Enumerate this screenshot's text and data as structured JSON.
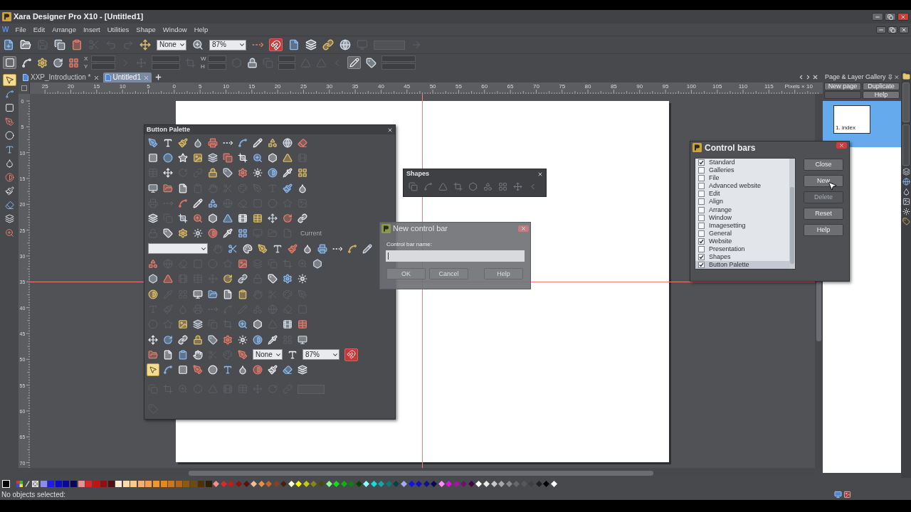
{
  "window": {
    "title": "Xara Designer Pro X10 - [Untitled1]"
  },
  "menu": {
    "doc_icon": "W",
    "items": [
      "File",
      "Edit",
      "Arrange",
      "Insert",
      "Utilities",
      "Shape",
      "Window",
      "Help"
    ]
  },
  "standard_bar": {
    "items": [
      {
        "kind": "button",
        "disabled": false
      },
      {
        "kind": "button",
        "disabled": false
      },
      {
        "kind": "button",
        "disabled": true
      },
      {
        "kind": "button",
        "disabled": false
      },
      {
        "kind": "button",
        "disabled": false
      },
      {
        "kind": "button",
        "disabled": true
      },
      {
        "kind": "button",
        "disabled": true
      },
      {
        "kind": "button",
        "disabled": true
      },
      {
        "kind": "button",
        "disabled": false
      },
      {
        "kind": "select",
        "value": "None"
      },
      {
        "kind": "button",
        "disabled": false
      },
      {
        "kind": "select",
        "value": "87%"
      },
      {
        "kind": "button",
        "disabled": false
      },
      {
        "kind": "toggle",
        "on": true
      },
      {
        "kind": "button",
        "disabled": false
      },
      {
        "kind": "button",
        "disabled": false
      },
      {
        "kind": "button",
        "disabled": false
      },
      {
        "kind": "button",
        "disabled": false
      },
      {
        "kind": "button",
        "disabled": true
      },
      {
        "kind": "field"
      },
      {
        "kind": "button",
        "disabled": true
      }
    ]
  },
  "info_bar": {
    "items": [
      {
        "kind": "toggle",
        "on": true
      },
      {
        "kind": "button",
        "disabled": false
      },
      {
        "kind": "button",
        "disabled": false
      },
      {
        "kind": "button",
        "disabled": false
      },
      {
        "kind": "button",
        "disabled": false
      },
      {
        "kind": "fields",
        "labels": [
          "X",
          "Y"
        ]
      },
      {
        "kind": "button",
        "disabled": true
      },
      {
        "kind": "button",
        "disabled": true
      },
      {
        "kind": "fields"
      },
      {
        "kind": "button",
        "disabled": true
      },
      {
        "kind": "fields",
        "labels": [
          "W",
          "H"
        ]
      },
      {
        "kind": "button",
        "disabled": true
      },
      {
        "kind": "button",
        "disabled": false
      },
      {
        "kind": "button",
        "disabled": true
      },
      {
        "kind": "fields"
      },
      {
        "kind": "button",
        "disabled": true
      },
      {
        "kind": "button",
        "disabled": true
      },
      {
        "kind": "button",
        "disabled": true
      },
      {
        "kind": "toggle",
        "on": true
      },
      {
        "kind": "button",
        "disabled": false
      },
      {
        "kind": "fields"
      }
    ]
  },
  "doc_tabs": [
    {
      "label": "XXP_Introduction *",
      "selected": false
    },
    {
      "label": "Untitled1",
      "selected": true
    }
  ],
  "toolbox": {
    "items": [
      {
        "selected": true
      },
      {
        "selected": false
      },
      {
        "selected": false
      },
      {
        "selected": false
      },
      {
        "selected": false
      },
      {
        "selected": false
      },
      {
        "selected": false
      },
      {
        "selected": false
      },
      {
        "selected": false
      },
      {
        "selected": false
      },
      {
        "selected": false
      },
      {
        "selected": false
      }
    ]
  },
  "rulers": {
    "horizontal": [
      "25",
      "20",
      "15",
      "10",
      "5",
      "0",
      "5",
      "10",
      "15",
      "20",
      "25",
      "30",
      "35",
      "40",
      "45",
      "50",
      "55",
      "60",
      "65",
      "70",
      "75",
      "80",
      "85",
      "90",
      "95",
      "100",
      "105",
      "110",
      "115"
    ],
    "unit": "Pixels × 10",
    "vertical": [
      "0",
      "5",
      "10",
      "15",
      "20",
      "25",
      "30",
      "35",
      "40",
      "45",
      "50",
      "55",
      "60",
      "65",
      "70"
    ]
  },
  "button_palette": {
    "title": "Button Palette",
    "rows": [
      {
        "items": [
          {
            "kind": "button",
            "disabled": false
          },
          {
            "kind": "button",
            "disabled": false
          },
          {
            "kind": "button",
            "disabled": false
          },
          {
            "kind": "button",
            "disabled": false
          },
          {
            "kind": "button",
            "disabled": false
          },
          {
            "kind": "button",
            "disabled": false
          },
          {
            "kind": "button",
            "disabled": false
          },
          {
            "kind": "button",
            "disabled": false
          },
          {
            "kind": "button",
            "disabled": false
          },
          {
            "kind": "button",
            "disabled": false
          },
          {
            "kind": "button",
            "disabled": false
          }
        ]
      },
      {
        "items": [
          {
            "kind": "button",
            "disabled": false
          },
          {
            "kind": "button",
            "disabled": false
          },
          {
            "kind": "button",
            "disabled": false
          },
          {
            "kind": "button",
            "disabled": false
          },
          {
            "kind": "button",
            "disabled": false
          },
          {
            "kind": "button",
            "disabled": false
          },
          {
            "kind": "button",
            "disabled": false
          },
          {
            "kind": "button",
            "disabled": false
          },
          {
            "kind": "button",
            "disabled": false
          },
          {
            "kind": "button",
            "disabled": false
          },
          {
            "kind": "button",
            "disabled": true
          }
        ]
      },
      {
        "items": [
          {
            "kind": "button",
            "disabled": true
          },
          {
            "kind": "button",
            "disabled": false
          },
          {
            "kind": "button",
            "disabled": true
          },
          {
            "kind": "button",
            "disabled": true
          },
          {
            "kind": "button",
            "disabled": false
          },
          {
            "kind": "button",
            "disabled": false
          },
          {
            "kind": "button",
            "disabled": false
          },
          {
            "kind": "button",
            "disabled": false
          },
          {
            "kind": "button",
            "disabled": false
          },
          {
            "kind": "button",
            "disabled": false
          },
          {
            "kind": "button",
            "disabled": false
          }
        ]
      },
      {
        "items": [
          {
            "kind": "button",
            "disabled": false
          },
          {
            "kind": "button",
            "disabled": false
          },
          {
            "kind": "button",
            "disabled": false
          },
          {
            "kind": "button",
            "disabled": true
          },
          {
            "kind": "button",
            "disabled": true
          },
          {
            "kind": "button",
            "disabled": true
          },
          {
            "kind": "button",
            "disabled": true
          },
          {
            "kind": "button",
            "disabled": true
          },
          {
            "kind": "button",
            "disabled": true
          },
          {
            "kind": "button",
            "disabled": false
          },
          {
            "kind": "button",
            "disabled": false
          }
        ]
      },
      {
        "items": [
          {
            "kind": "button",
            "disabled": true
          },
          {
            "kind": "button",
            "disabled": true
          },
          {
            "kind": "button",
            "disabled": false
          },
          {
            "kind": "button",
            "disabled": false
          },
          {
            "kind": "button",
            "disabled": false
          },
          {
            "kind": "button",
            "disabled": true
          },
          {
            "kind": "button",
            "disabled": true
          },
          {
            "kind": "button",
            "disabled": true
          },
          {
            "kind": "button",
            "disabled": true
          },
          {
            "kind": "button",
            "disabled": true
          },
          {
            "kind": "button",
            "disabled": true
          }
        ]
      },
      {
        "items": [
          {
            "kind": "button",
            "disabled": false
          },
          {
            "kind": "button",
            "disabled": true
          },
          {
            "kind": "button",
            "disabled": false
          },
          {
            "kind": "button",
            "disabled": false
          },
          {
            "kind": "button",
            "disabled": false
          },
          {
            "kind": "button",
            "disabled": false
          },
          {
            "kind": "button",
            "disabled": false
          },
          {
            "kind": "button",
            "disabled": false
          },
          {
            "kind": "button",
            "disabled": false
          },
          {
            "kind": "button",
            "disabled": false
          },
          {
            "kind": "button",
            "disabled": false
          }
        ]
      },
      {
        "items": [
          {
            "kind": "button",
            "disabled": true
          },
          {
            "kind": "button",
            "disabled": false
          },
          {
            "kind": "button",
            "disabled": false
          },
          {
            "kind": "button",
            "disabled": false
          },
          {
            "kind": "button",
            "disabled": false
          },
          {
            "kind": "button",
            "disabled": false
          },
          {
            "kind": "button",
            "disabled": false
          },
          {
            "kind": "button",
            "disabled": true
          },
          {
            "kind": "button",
            "disabled": true
          },
          {
            "kind": "button",
            "disabled": true
          },
          {
            "kind": "label",
            "text": "Current",
            "disabled": true
          }
        ]
      },
      {
        "items": [
          {
            "kind": "select"
          },
          {
            "kind": "button",
            "disabled": true
          },
          {
            "kind": "button",
            "disabled": false
          },
          {
            "kind": "button",
            "disabled": false
          },
          {
            "kind": "button",
            "disabled": false
          },
          {
            "kind": "button",
            "disabled": false
          },
          {
            "kind": "button",
            "disabled": false
          },
          {
            "kind": "button",
            "disabled": false
          },
          {
            "kind": "button",
            "disabled": false
          },
          {
            "kind": "button",
            "disabled": false
          },
          {
            "kind": "button",
            "disabled": false
          },
          {
            "kind": "button",
            "disabled": false
          }
        ]
      },
      {
        "items": [
          {
            "kind": "button",
            "disabled": false
          },
          {
            "kind": "button",
            "disabled": true
          },
          {
            "kind": "button",
            "disabled": true
          },
          {
            "kind": "button",
            "disabled": true
          },
          {
            "kind": "button",
            "disabled": true
          },
          {
            "kind": "button",
            "disabled": true
          },
          {
            "kind": "button",
            "disabled": false
          },
          {
            "kind": "button",
            "disabled": true
          },
          {
            "kind": "button",
            "disabled": true
          },
          {
            "kind": "button",
            "disabled": true
          },
          {
            "kind": "button",
            "disabled": true
          },
          {
            "kind": "button",
            "disabled": false
          }
        ]
      },
      {
        "items": [
          {
            "kind": "button",
            "disabled": false
          },
          {
            "kind": "button",
            "disabled": false
          },
          {
            "kind": "button",
            "disabled": true
          },
          {
            "kind": "button",
            "disabled": true
          },
          {
            "kind": "button",
            "disabled": true
          },
          {
            "kind": "button",
            "disabled": false
          },
          {
            "kind": "button",
            "disabled": false
          },
          {
            "kind": "button",
            "disabled": true
          },
          {
            "kind": "button",
            "disabled": false
          },
          {
            "kind": "button",
            "disabled": false
          },
          {
            "kind": "button",
            "disabled": false
          }
        ]
      },
      {
        "items": [
          {
            "kind": "button",
            "disabled": false
          },
          {
            "kind": "button",
            "disabled": true
          },
          {
            "kind": "button",
            "disabled": true
          },
          {
            "kind": "button",
            "disabled": false
          },
          {
            "kind": "button",
            "disabled": false
          },
          {
            "kind": "button",
            "disabled": false
          },
          {
            "kind": "button",
            "disabled": false
          },
          {
            "kind": "button",
            "disabled": true
          },
          {
            "kind": "button",
            "disabled": true
          },
          {
            "kind": "button",
            "disabled": true
          },
          {
            "kind": "button",
            "disabled": true
          }
        ]
      },
      {
        "items": [
          {
            "kind": "button",
            "disabled": true
          },
          {
            "kind": "button",
            "disabled": true
          },
          {
            "kind": "button",
            "disabled": true
          },
          {
            "kind": "button",
            "disabled": true
          },
          {
            "kind": "button",
            "disabled": true
          },
          {
            "kind": "button",
            "disabled": true
          },
          {
            "kind": "button",
            "disabled": true
          },
          {
            "kind": "button",
            "disabled": true
          },
          {
            "kind": "button",
            "disabled": true
          },
          {
            "kind": "button",
            "disabled": true
          },
          {
            "kind": "button",
            "disabled": true
          }
        ]
      },
      {
        "items": [
          {
            "kind": "button",
            "disabled": true
          },
          {
            "kind": "button",
            "disabled": true
          },
          {
            "kind": "button",
            "disabled": false
          },
          {
            "kind": "button",
            "disabled": false
          },
          {
            "kind": "button",
            "disabled": true
          },
          {
            "kind": "button",
            "disabled": true
          },
          {
            "kind": "button",
            "disabled": false
          },
          {
            "kind": "button",
            "disabled": false
          },
          {
            "kind": "button",
            "disabled": true
          },
          {
            "kind": "button",
            "disabled": false
          },
          {
            "kind": "button",
            "disabled": false
          }
        ]
      },
      {
        "items": [
          {
            "kind": "button",
            "disabled": false
          },
          {
            "kind": "button",
            "disabled": false
          },
          {
            "kind": "button",
            "disabled": false
          },
          {
            "kind": "button",
            "disabled": false
          },
          {
            "kind": "button",
            "disabled": false
          },
          {
            "kind": "button",
            "disabled": false
          },
          {
            "kind": "button",
            "disabled": false
          },
          {
            "kind": "button",
            "disabled": false
          },
          {
            "kind": "button",
            "disabled": false
          },
          {
            "kind": "button",
            "disabled": true
          },
          {
            "kind": "button",
            "disabled": false
          }
        ]
      },
      {
        "items": [
          {
            "kind": "button",
            "disabled": false
          },
          {
            "kind": "button",
            "disabled": false
          },
          {
            "kind": "button",
            "disabled": false
          },
          {
            "kind": "button",
            "disabled": false
          },
          {
            "kind": "button",
            "disabled": true
          },
          {
            "kind": "button",
            "disabled": true
          },
          {
            "kind": "button",
            "disabled": false
          },
          {
            "kind": "select",
            "value": "None"
          },
          {
            "kind": "button",
            "disabled": false
          },
          {
            "kind": "select",
            "value": "87%"
          },
          {
            "kind": "toggle",
            "on": true
          }
        ]
      },
      {
        "items": [
          {
            "kind": "button",
            "disabled": false,
            "active": true
          },
          {
            "kind": "button",
            "disabled": false,
            "active": false
          },
          {
            "kind": "button",
            "disabled": false,
            "active": false
          },
          {
            "kind": "button",
            "disabled": false,
            "active": false
          },
          {
            "kind": "button",
            "disabled": false,
            "active": false
          },
          {
            "kind": "button",
            "disabled": false,
            "active": false
          },
          {
            "kind": "button",
            "disabled": false,
            "active": false
          },
          {
            "kind": "button",
            "disabled": false,
            "active": false
          },
          {
            "kind": "button",
            "disabled": false,
            "active": false
          },
          {
            "kind": "button",
            "disabled": false,
            "active": false
          },
          {
            "kind": "button",
            "disabled": false,
            "active": false
          }
        ]
      },
      {
        "items": [
          {
            "kind": "button",
            "disabled": true
          },
          {
            "kind": "button",
            "disabled": true
          },
          {
            "kind": "button",
            "disabled": true
          },
          {
            "kind": "button",
            "disabled": true
          },
          {
            "kind": "button",
            "disabled": true
          },
          {
            "kind": "button",
            "disabled": true
          },
          {
            "kind": "button",
            "disabled": true
          },
          {
            "kind": "button",
            "disabled": true
          },
          {
            "kind": "button",
            "disabled": true
          },
          {
            "kind": "button",
            "disabled": true
          },
          {
            "kind": "field"
          }
        ]
      },
      {
        "items": [
          {
            "kind": "button",
            "disabled": true
          }
        ]
      }
    ]
  },
  "shapes_bar": {
    "title": "Shapes",
    "items": [
      {
        "disabled": true
      },
      {
        "disabled": true
      },
      {
        "disabled": true
      },
      {
        "disabled": true
      },
      {
        "disabled": true
      },
      {
        "disabled": true
      },
      {
        "disabled": true
      },
      {
        "disabled": true
      },
      {
        "disabled": true
      }
    ]
  },
  "new_control_bar": {
    "title": "New control bar",
    "label": "Control bar name:",
    "buttons": [
      "OK",
      "Cancel",
      "Help"
    ]
  },
  "control_bars": {
    "title": "Control bars",
    "items": [
      {
        "label": "Standard",
        "checked": true,
        "selected": false
      },
      {
        "label": "Galleries",
        "checked": false,
        "selected": false
      },
      {
        "label": "File",
        "checked": false,
        "selected": false
      },
      {
        "label": "Advanced website",
        "checked": false,
        "selected": false
      },
      {
        "label": "Edit",
        "checked": false,
        "selected": false
      },
      {
        "label": "Align",
        "checked": false,
        "selected": false
      },
      {
        "label": "Arrange",
        "checked": false,
        "selected": false
      },
      {
        "label": "Window",
        "checked": false,
        "selected": false
      },
      {
        "label": "Imagesetting",
        "checked": false,
        "selected": false
      },
      {
        "label": "General",
        "checked": false,
        "selected": false
      },
      {
        "label": "Website",
        "checked": true,
        "selected": false
      },
      {
        "label": "Presentation",
        "checked": false,
        "selected": false
      },
      {
        "label": "Shapes",
        "checked": true,
        "selected": false
      },
      {
        "label": "Button Palette",
        "checked": true,
        "selected": true
      }
    ],
    "buttons": [
      {
        "label": "Close",
        "disabled": false
      },
      {
        "label": "New",
        "disabled": false
      },
      {
        "label": "Delete",
        "disabled": true
      },
      {
        "label": "Reset",
        "disabled": false
      },
      {
        "label": "Help",
        "disabled": false
      }
    ]
  },
  "gallery": {
    "title": "Page & Layer Gallery",
    "buttons": [
      {
        "label": "New page",
        "disabled": false
      },
      {
        "label": "Duplicate",
        "disabled": false
      },
      {
        "disabled": true
      },
      {
        "label": "Help",
        "disabled": false
      }
    ],
    "pages": [
      {
        "label": "1. index",
        "selected": true
      }
    ]
  },
  "palette": {
    "swatches": [
      {
        "kind": "square",
        "color": "#8c8cf0"
      },
      {
        "kind": "square",
        "color": "#1c1cf0"
      },
      {
        "kind": "square",
        "color": "#0c0cc8"
      },
      {
        "kind": "square",
        "color": "#08089a"
      },
      {
        "kind": "square",
        "color": "#060660"
      },
      {
        "kind": "square",
        "color": "#e89090"
      },
      {
        "kind": "square",
        "color": "#e02424"
      },
      {
        "kind": "square",
        "color": "#c81010"
      },
      {
        "kind": "square",
        "color": "#901010"
      },
      {
        "kind": "square",
        "color": "#501010"
      },
      {
        "kind": "square",
        "color": "#ffe8d0"
      },
      {
        "kind": "square",
        "color": "#ffd8b0"
      },
      {
        "kind": "square",
        "color": "#f8c890"
      },
      {
        "kind": "square",
        "color": "#f0b070"
      },
      {
        "kind": "square",
        "color": "#f0a050"
      },
      {
        "kind": "square",
        "color": "#f09828"
      },
      {
        "kind": "square",
        "color": "#e88818"
      },
      {
        "kind": "square",
        "color": "#c87820"
      },
      {
        "kind": "square",
        "color": "#b06818"
      },
      {
        "kind": "square",
        "color": "#905818"
      },
      {
        "kind": "square",
        "color": "#704810"
      },
      {
        "kind": "square",
        "color": "#503008"
      },
      {
        "kind": "square",
        "color": "#302008"
      },
      {
        "kind": "diamond",
        "color": "#f09090"
      },
      {
        "kind": "diamond",
        "color": "#e02828"
      },
      {
        "kind": "diamond",
        "color": "#c81818"
      },
      {
        "kind": "diamond",
        "color": "#901010"
      },
      {
        "kind": "diamond",
        "color": "#581010"
      },
      {
        "kind": "diamond",
        "color": "#f0c098"
      },
      {
        "kind": "diamond",
        "color": "#e89048"
      },
      {
        "kind": "diamond",
        "color": "#c86828"
      },
      {
        "kind": "diamond",
        "color": "#884020"
      },
      {
        "kind": "diamond",
        "color": "#482010"
      },
      {
        "kind": "diamond",
        "color": "#ffffd0"
      },
      {
        "kind": "diamond",
        "color": "#f8f800"
      },
      {
        "kind": "diamond",
        "color": "#c8c810"
      },
      {
        "kind": "diamond",
        "color": "#888810"
      },
      {
        "kind": "diamond",
        "color": "#484808"
      },
      {
        "kind": "diamond",
        "color": "#90f890"
      },
      {
        "kind": "diamond",
        "color": "#10e010"
      },
      {
        "kind": "diamond",
        "color": "#10b010"
      },
      {
        "kind": "diamond",
        "color": "#108010"
      },
      {
        "kind": "diamond",
        "color": "#084008"
      },
      {
        "kind": "diamond",
        "color": "#90f8f8"
      },
      {
        "kind": "diamond",
        "color": "#10e0e0"
      },
      {
        "kind": "diamond",
        "color": "#10a8a8"
      },
      {
        "kind": "diamond",
        "color": "#107878"
      },
      {
        "kind": "diamond",
        "color": "#084040"
      },
      {
        "kind": "diamond",
        "color": "#a8a8f8"
      },
      {
        "kind": "diamond",
        "color": "#1010f0"
      },
      {
        "kind": "diamond",
        "color": "#1010c0"
      },
      {
        "kind": "diamond",
        "color": "#101090"
      },
      {
        "kind": "diamond",
        "color": "#080850"
      },
      {
        "kind": "diamond",
        "color": "#f890f8"
      },
      {
        "kind": "diamond",
        "color": "#e010e0"
      },
      {
        "kind": "diamond",
        "color": "#a810a8"
      },
      {
        "kind": "diamond",
        "color": "#701070"
      },
      {
        "kind": "diamond",
        "color": "#400840"
      },
      {
        "kind": "diamond",
        "color": "#ffffff"
      },
      {
        "kind": "diamond",
        "color": "#e8e8e8"
      },
      {
        "kind": "diamond",
        "color": "#c8c8c8"
      },
      {
        "kind": "diamond",
        "color": "#a8a8a8"
      },
      {
        "kind": "diamond",
        "color": "#888888"
      },
      {
        "kind": "diamond",
        "color": "#686868"
      },
      {
        "kind": "diamond",
        "color": "#585858"
      },
      {
        "kind": "diamond",
        "color": "#404040"
      },
      {
        "kind": "diamond",
        "color": "#202020"
      },
      {
        "kind": "diamond",
        "color": "#000000"
      },
      {
        "kind": "diamond",
        "color": "#ffffff"
      }
    ]
  },
  "status_bar": {
    "text": "No objects selected:"
  }
}
